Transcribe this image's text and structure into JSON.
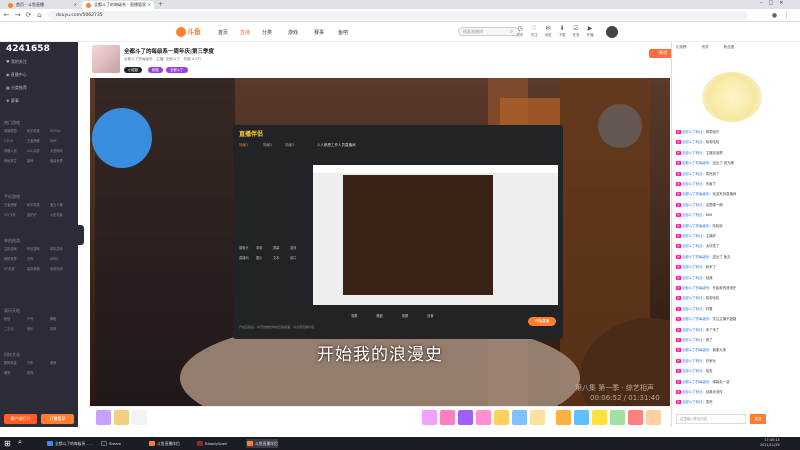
{
  "browser": {
    "tabs": [
      {
        "title": "首页 - 斗鱼直播",
        "active": false,
        "color": "#ff7d2f"
      },
      {
        "title": "全都斗了的每级系 - 直播管家",
        "active": true,
        "color": "#ff7d2f"
      },
      {
        "title": "",
        "active": false,
        "color": "#888"
      }
    ],
    "url": "douyu.com/5062735"
  },
  "site": {
    "logo": "斗鱼",
    "nav": [
      "首页",
      "直播",
      "分类",
      "游戏",
      "赛事",
      "鱼吧"
    ],
    "active_nav": 1,
    "search_placeholder": "搜索直播间",
    "header_icons": [
      {
        "icon": "history-icon",
        "label": "历史"
      },
      {
        "icon": "follow-icon",
        "label": "关注"
      },
      {
        "icon": "message-icon",
        "label": "消息"
      },
      {
        "icon": "download-icon",
        "label": "下载"
      },
      {
        "icon": "task-icon",
        "label": "任务"
      },
      {
        "icon": "live-icon",
        "label": "开播"
      }
    ]
  },
  "leftbar": {
    "room_number": "4241658",
    "items": [
      "我的关注",
      "直播中心",
      "分类推荐",
      "赛事"
    ],
    "sections": [
      {
        "title": "热门游戏",
        "games": [
          "英雄联盟",
          "和平精英",
          "DOTA2",
          "CSGO",
          "王者荣耀",
          "DNF",
          "穿越火线",
          "LOL手游",
          "天涯明月",
          "绝地求生",
          "原神",
          "魔兽世界"
        ]
      },
      {
        "title": "手机游戏",
        "games": [
          "王者荣耀",
          "和平精英",
          "第五人格",
          "QQ飞车",
          "金铲铲",
          "火影忍者"
        ]
      },
      {
        "title": "单机热游",
        "games": [
          "主机游戏",
          "怀旧游戏",
          "单机游戏",
          "我的世界",
          "方舟",
          "APEX",
          "CF手游",
          "星际争霸",
          "永劫无间"
        ]
      },
      {
        "title": "娱乐天地",
        "games": [
          "颜值",
          "户外",
          "舞蹈",
          "二次元",
          "音乐",
          "体育"
        ]
      },
      {
        "title": "科技文化",
        "games": [
          "数码科技",
          "汽车",
          "美食",
          "萌宠",
          "影视"
        ]
      }
    ],
    "btn_left": "客户端打开",
    "btn_right": "开播管家"
  },
  "room": {
    "title": "全都斗了的每级系一周年庆|第三季度",
    "subtitle": "全都斗了的每级系 · 主播: 全部斗了 · 热度 4.3万",
    "tags": [
      "小姐姐",
      "颜值",
      "全都斗了"
    ],
    "follow_label": "关注"
  },
  "overlay_app": {
    "app_name": "直播伴侣",
    "tabs": [
      "场景1",
      "场景2",
      "场景3"
    ],
    "stream_title": "人人都是工作人员直播间",
    "tools": [
      "摄像头",
      "录制",
      "屏幕",
      "游戏",
      "直播间",
      "图片",
      "文本",
      "窗口"
    ],
    "bottom_bar": [
      "录屏",
      "播放",
      "投屏",
      "设置"
    ],
    "start_button": "开始直播",
    "notice": "开启直播后，将开始推送你的直播画面，请注意直播内容"
  },
  "video": {
    "subtitle": "开始我的浪漫史",
    "watermark_line1": "第八集 第一季 · 综艺相声",
    "watermark_line2": "00:06:52 / 01:31:40"
  },
  "dock": {
    "gift_count": 20
  },
  "chat": {
    "header_tabs": [
      "礼物榜",
      "贵宾",
      "粉丝团"
    ],
    "messages": [
      {
        "user": "全部斗了粉丝",
        "text": "带带我们"
      },
      {
        "user": "全部斗了粉丝",
        "text": "哈哈哈哈"
      },
      {
        "user": "全部斗了粉丝",
        "text": "主播加油啊"
      },
      {
        "user": "全都斗了的每级系",
        "text": "送出了 荧光棒"
      },
      {
        "user": "全部斗了粉丝",
        "text": "笑死我了"
      },
      {
        "user": "全部斗了粉丝",
        "text": "厉害了"
      },
      {
        "user": "全都斗了的每级系",
        "text": "欢迎来到直播间"
      },
      {
        "user": "全部斗了粉丝",
        "text": "这是哪一期"
      },
      {
        "user": "全部斗了粉丝",
        "text": "666"
      },
      {
        "user": "全都斗了的每级系",
        "text": "哈哈哈"
      },
      {
        "user": "全部斗了粉丝",
        "text": "主播好"
      },
      {
        "user": "全部斗了粉丝",
        "text": "太好笑了"
      },
      {
        "user": "全都斗了的每级系",
        "text": "送出了 鱼丸"
      },
      {
        "user": "全部斗了粉丝",
        "text": "我来了"
      },
      {
        "user": "全部斗了粉丝",
        "text": "经典"
      },
      {
        "user": "全都斗了的每级系",
        "text": "开始我的浪漫史"
      },
      {
        "user": "全部斗了粉丝",
        "text": "哈哈哈哈"
      },
      {
        "user": "全部斗了粉丝",
        "text": "好看"
      },
      {
        "user": "全都斗了的每级系",
        "text": "关注主播不迷路"
      },
      {
        "user": "全部斗了粉丝",
        "text": "来了来了"
      },
      {
        "user": "全部斗了粉丝",
        "text": "绝了"
      },
      {
        "user": "全都斗了的每级系",
        "text": "谢谢大家"
      },
      {
        "user": "全部斗了粉丝",
        "text": "好家伙"
      },
      {
        "user": "全部斗了粉丝",
        "text": "哈哈"
      },
      {
        "user": "全都斗了的每级系",
        "text": "弹幕走一波"
      },
      {
        "user": "全部斗了粉丝",
        "text": "经典永流传"
      },
      {
        "user": "全部斗了粉丝",
        "text": "笑死"
      }
    ],
    "input_placeholder": "这里输入聊天内容",
    "send_label": "发送"
  },
  "taskbar": {
    "items": [
      {
        "label": "全都斗了的每级系 - ...",
        "color": "#4285f4"
      },
      {
        "label": "Steam",
        "color": "#1b2838"
      },
      {
        "label": "斗鱼直播伴侣",
        "color": "#ff7d2f"
      },
      {
        "label": "BloodySpell",
        "color": "#8b2b2b"
      },
      {
        "label": "斗鱼直播伴侣",
        "color": "#ff7d2f"
      }
    ],
    "time": "17:40:13",
    "date": "2021/11/29"
  }
}
